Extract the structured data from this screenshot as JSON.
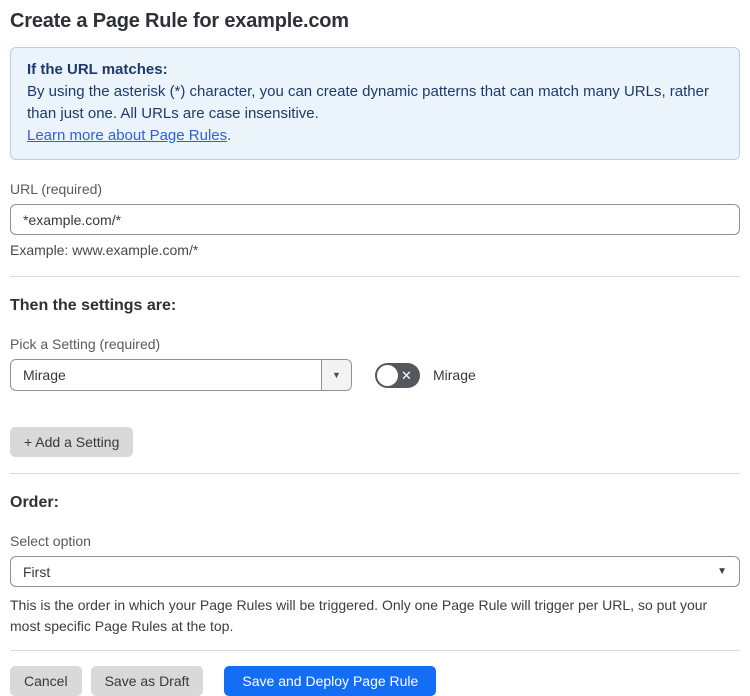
{
  "page": {
    "title": "Create a Page Rule for example.com"
  },
  "info_box": {
    "heading": "If the URL matches:",
    "body": "By using the asterisk (*) character, you can create dynamic patterns that can match many URLs, rather than just one. All URLs are case insensitive.",
    "link_label": "Learn more about Page Rules",
    "link_suffix": "."
  },
  "url_field": {
    "label": "URL (required)",
    "value": "*example.com/*",
    "example": "Example: www.example.com/*"
  },
  "settings_section": {
    "heading": "Then the settings are:",
    "picker_label": "Pick a Setting (required)",
    "picker_value": "Mirage",
    "toggle_state": "off",
    "toggle_label": "Mirage",
    "add_button_label": "+ Add a Setting"
  },
  "order_section": {
    "heading": "Order:",
    "select_label": "Select option",
    "select_value": "First",
    "help_text": "This is the order in which your Page Rules will be triggered. Only one Page Rule will trigger per URL, so put your most specific Page Rules at the top."
  },
  "footer": {
    "cancel_label": "Cancel",
    "save_draft_label": "Save as Draft",
    "save_deploy_label": "Save and Deploy Page Rule"
  },
  "icons": {
    "caret_down": "▼",
    "toggle_x": "✕"
  },
  "colors": {
    "info_box_bg": "#ecf4fb",
    "info_box_border": "#aed3f2",
    "info_text": "#1e3a6d",
    "link_blue": "#2c62d9",
    "primary_button_blue": "#146ef5",
    "gray_button_bg": "#d9d9d9",
    "toggle_off_bg": "#54575b"
  }
}
